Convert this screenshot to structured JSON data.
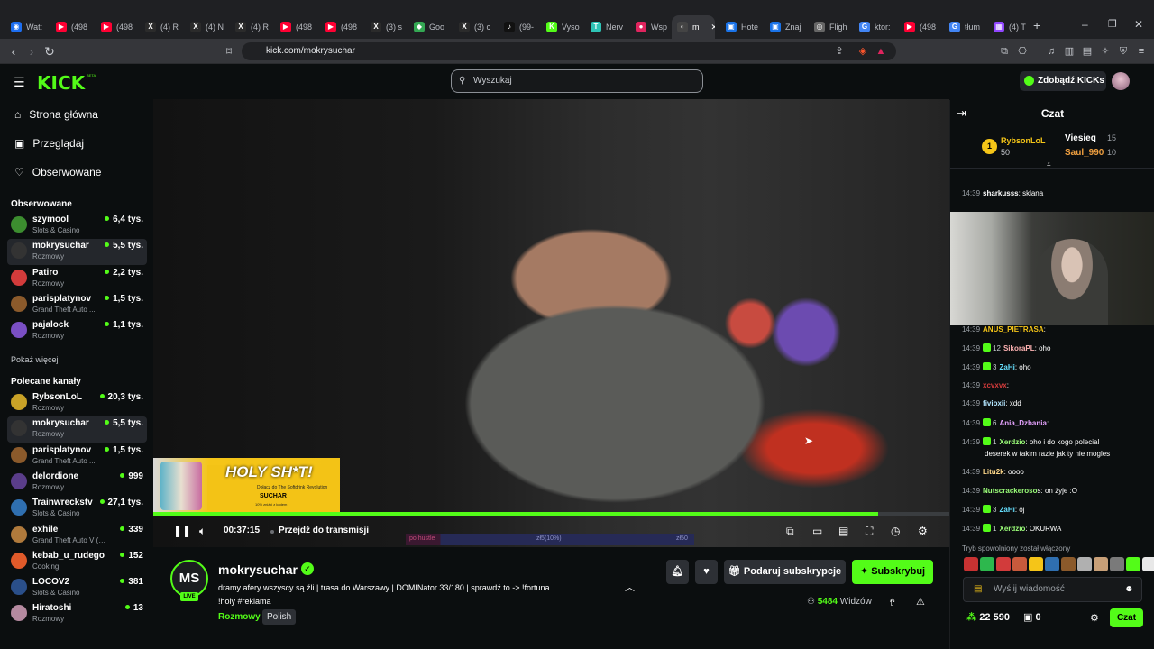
{
  "browser": {
    "tabs": [
      {
        "label": "Wat:",
        "color": "#1d6ef0",
        "glyph": "◉"
      },
      {
        "label": "(498",
        "color": "#ff0033",
        "glyph": "▶"
      },
      {
        "label": "(498",
        "color": "#ff0033",
        "glyph": "▶"
      },
      {
        "label": "(4) R",
        "color": "#2b2b2b",
        "glyph": "X"
      },
      {
        "label": "(4) N",
        "color": "#2b2b2b",
        "glyph": "X"
      },
      {
        "label": "(4) R",
        "color": "#2b2b2b",
        "glyph": "X"
      },
      {
        "label": "(498",
        "color": "#ff0033",
        "glyph": "▶"
      },
      {
        "label": "(498",
        "color": "#ff0033",
        "glyph": "▶"
      },
      {
        "label": "(3) s",
        "color": "#2b2b2b",
        "glyph": "X"
      },
      {
        "label": "Goo",
        "color": "#34a853",
        "glyph": "◆"
      },
      {
        "label": "(3) c",
        "color": "#2b2b2b",
        "glyph": "X"
      },
      {
        "label": "(99-",
        "color": "#111111",
        "glyph": "♪"
      },
      {
        "label": "Vyso",
        "color": "#53fc18",
        "glyph": "K"
      },
      {
        "label": "Nerv",
        "color": "#2ec4b6",
        "glyph": "T"
      },
      {
        "label": "Wsp",
        "color": "#e0245e",
        "glyph": "●"
      },
      {
        "label": "m",
        "color": "#444444",
        "glyph": "◐"
      },
      {
        "label": "Hote",
        "color": "#1a73e8",
        "glyph": "▣"
      },
      {
        "label": "Znaj",
        "color": "#1a73e8",
        "glyph": "▣"
      },
      {
        "label": "Fligh",
        "color": "#666666",
        "glyph": "◎"
      },
      {
        "label": "ktor:",
        "color": "#4285f4",
        "glyph": "G"
      },
      {
        "label": "(498",
        "color": "#ff0033",
        "glyph": "▶"
      },
      {
        "label": "tłum",
        "color": "#4285f4",
        "glyph": "G"
      },
      {
        "label": "(4) T",
        "color": "#9146ff",
        "glyph": "▦"
      }
    ],
    "url": "kick.com/mokrysuchar"
  },
  "header": {
    "logo": "KICK",
    "beta": "BETA",
    "search_placeholder": "Wyszukaj",
    "kicks_button": "Zdobądź KICKs"
  },
  "sidebar": {
    "nav": [
      "Strona główna",
      "Przeglądaj",
      "Obserwowane"
    ],
    "followed_title": "Obserwowane",
    "followed": [
      {
        "name": "szymool",
        "category": "Slots & Casino",
        "viewers": "6,4 tys.",
        "color": "#3c8d2f"
      },
      {
        "name": "mokrysuchar",
        "category": "Rozmowy",
        "viewers": "5,5 tys.",
        "color": "#333333",
        "selected": true
      },
      {
        "name": "Patiro",
        "category": "Rozmowy",
        "viewers": "2,2 tys.",
        "color": "#d23b3b"
      },
      {
        "name": "parisplatynov",
        "category": "Grand Theft Auto ...",
        "viewers": "1,5 tys.",
        "color": "#8b5a2b"
      },
      {
        "name": "pajalock",
        "category": "Rozmowy",
        "viewers": "1,1 tys.",
        "color": "#7a4fc4"
      }
    ],
    "show_more": "Pokaż więcej",
    "recommended_title": "Polecane kanały",
    "recommended": [
      {
        "name": "RybsonLoL",
        "category": "Rozmowy",
        "viewers": "20,3 tys.",
        "color": "#c9a227"
      },
      {
        "name": "mokrysuchar",
        "category": "Rozmowy",
        "viewers": "5,5 tys.",
        "color": "#333333",
        "selected": true
      },
      {
        "name": "parisplatynov",
        "category": "Grand Theft Auto ...",
        "viewers": "1,5 tys.",
        "color": "#8b5a2b"
      },
      {
        "name": "delordione",
        "category": "Rozmowy",
        "viewers": "999",
        "color": "#5a3d8a"
      },
      {
        "name": "Trainwreckstv",
        "category": "Slots & Casino",
        "viewers": "27,1 tys.",
        "color": "#2f6fb0"
      },
      {
        "name": "exhile",
        "category": "Grand Theft Auto V (G...",
        "viewers": "339",
        "color": "#b07a3c"
      },
      {
        "name": "kebab_u_rudego",
        "category": "Cooking",
        "viewers": "152",
        "color": "#e05a2a"
      },
      {
        "name": "LOCOV2",
        "category": "Slots & Casino",
        "viewers": "381",
        "color": "#2a4f8a"
      },
      {
        "name": "Hiratoshi",
        "category": "Rozmowy",
        "viewers": "13",
        "color": "#b58aa0"
      }
    ]
  },
  "video": {
    "promo_title": "HOLY SH*T!",
    "promo_sub": "Dołącz do The Softdrink Revolution",
    "promo_brand": "SUCHAR",
    "promo_small": "10% zniżki z kodem",
    "timecode": "00:37:15",
    "jump_live": "Przejdź do transmisji",
    "progress_fraction": 0.91,
    "goal_left": "po hustle",
    "goal_mid": "zł5(10%)",
    "goal_right": "zł50"
  },
  "stream": {
    "avatar_initials": "MS",
    "live": "LIVE",
    "streamer": "mokrysuchar",
    "title": "dramy afery wszyscy są źli | trasa do Warszawy | DOMINator 33/180 | sprawdź to -> !fortuna !holy #reklama",
    "category": "Rozmowy",
    "language": "Polish",
    "gift_label": "Podaruj subskrypcje",
    "subscribe_label": "Subskrybuj",
    "viewers_count": "5484",
    "viewers_label": "Widzów"
  },
  "chat": {
    "title": "Czat",
    "pinned": {
      "first_name": "RybsonLoL",
      "first_amount": "50",
      "second_name": "Viesieq",
      "second_amount": "15",
      "third_name": "Saul_990",
      "third_amount": "10",
      "rank": "1"
    },
    "messages_top": [
      {
        "time": "14:39",
        "user": "sharkusss",
        "text": ": sklana",
        "color": "#ffffff"
      }
    ],
    "messages": [
      {
        "time": "14:39",
        "user": "ANUS_PIETRASA",
        "text": ":",
        "color": "#f5c518"
      },
      {
        "time": "14:39",
        "user": "SikoraPL",
        "text": ": oho",
        "color": "#ffb3b3",
        "badge": "12"
      },
      {
        "time": "14:39",
        "user": "ZaHi",
        "text": ": oho",
        "color": "#66e0ff",
        "badge": "3"
      },
      {
        "time": "14:39",
        "user": "xcvxvx",
        "text": ":",
        "color": "#d23b3b"
      },
      {
        "time": "14:39",
        "user": "fivioxii",
        "text": ": xdd",
        "color": "#b3e6ff"
      },
      {
        "time": "14:39",
        "user": "Ania_Dzbania",
        "text": ":",
        "color": "#e6a3ff",
        "badge": "6"
      },
      {
        "time": "14:39",
        "user": "Xerdzio",
        "text": ": oho i do kogo polecial",
        "color": "#9cff7a",
        "badge": "1"
      },
      {
        "time": "",
        "user": "",
        "text": "deserek w takim razie jak ty nie mogles",
        "color": "#ffffff"
      },
      {
        "time": "14:39",
        "user": "Litu2k",
        "text": ": oooo",
        "color": "#ffd98a"
      },
      {
        "time": "14:39",
        "user": "Nutscrackeroso",
        "text": "s: on żyje :O",
        "color": "#9cff7a"
      },
      {
        "time": "14:39",
        "user": "ZaHi",
        "text": ": oj",
        "color": "#66e0ff",
        "badge": "3"
      },
      {
        "time": "14:39",
        "user": "Xerdzio",
        "text": ": OKURWA",
        "color": "#9cff7a",
        "badge": "1"
      }
    ],
    "slow_mode": "Tryb spowolniony został włączony",
    "input_placeholder": "Wyślij wiadomość",
    "points": "22 590",
    "points2": "0",
    "chat_button": "Czat"
  }
}
